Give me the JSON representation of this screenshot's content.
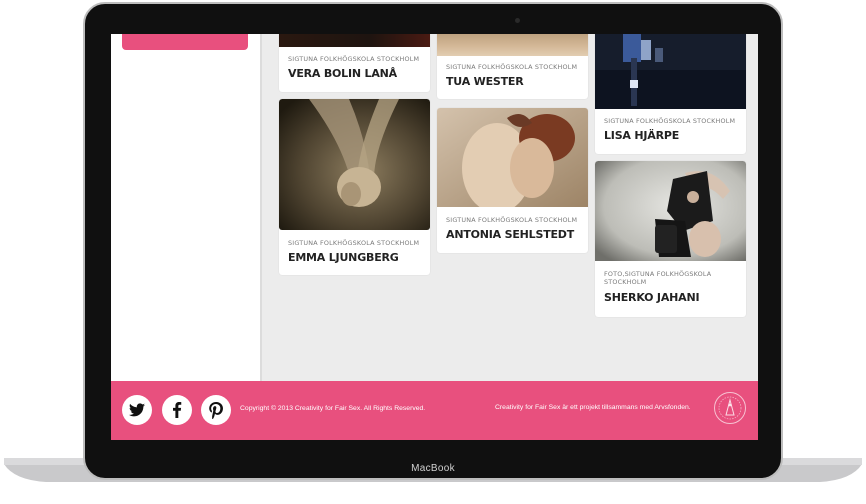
{
  "device": {
    "brand_label": "MacBook"
  },
  "cards": [
    {
      "school": "SIGTUNA FOLKHÖGSKOLA STOCKHOLM",
      "name": "VERA BOLIN LANÅ"
    },
    {
      "school": "SIGTUNA FOLKHÖGSKOLA STOCKHOLM",
      "name": "EMMA LJUNGBERG"
    },
    {
      "school": "SIGTUNA FOLKHÖGSKOLA STOCKHOLM",
      "name": "TUA WESTER"
    },
    {
      "school": "SIGTUNA FOLKHÖGSKOLA STOCKHOLM",
      "name": "ANTONIA SEHLSTEDT"
    },
    {
      "school": "SIGTUNA FOLKHÖGSKOLA STOCKHOLM",
      "name": "LISA HJÄRPE"
    },
    {
      "school": "FOTO,SIGTUNA FOLKHÖGSKOLA STOCKHOLM",
      "name": "SHERKO JAHANI"
    }
  ],
  "footer": {
    "social": [
      "twitter-icon",
      "facebook-icon",
      "pinterest-icon"
    ],
    "copyright": "Copyright © 2013 Creativity for Fair Sex. All Rights Reserved.",
    "project": "Creativity for Fair Sex är ett projekt tillsammans med Arvsfonden."
  },
  "colors": {
    "accent": "#e8507e",
    "background": "#ececec",
    "card": "#ffffff"
  }
}
